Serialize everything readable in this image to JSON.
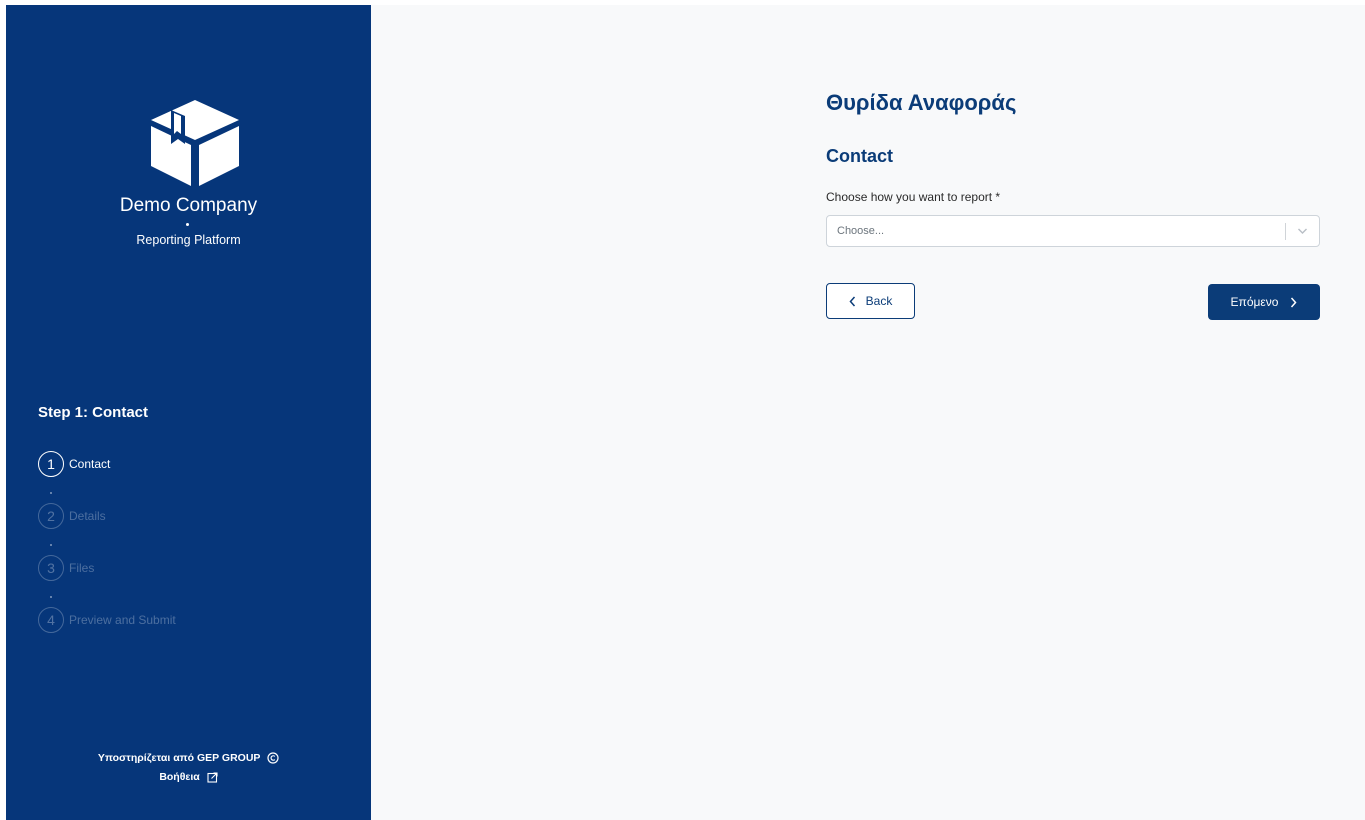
{
  "sidebar": {
    "company_name": "Demo Company",
    "platform_name": "Reporting Platform",
    "logo_icon": "box-icon",
    "step_title": "Step 1: Contact",
    "steps": [
      {
        "number": "1",
        "label": "Contact",
        "active": true
      },
      {
        "number": "2",
        "label": "Details",
        "active": false
      },
      {
        "number": "3",
        "label": "Files",
        "active": false
      },
      {
        "number": "4",
        "label": "Preview and Submit",
        "active": false
      }
    ],
    "footer": {
      "powered_by": "Υποστηρίζεται από GEP GROUP",
      "powered_icon": "copyright-icon",
      "help": "Βοήθεια",
      "help_icon": "external-link-icon"
    }
  },
  "main": {
    "page_title": "Θυρίδα Αναφοράς",
    "section_title": "Contact",
    "report_method": {
      "label": "Choose how you want to report *",
      "placeholder": "Choose..."
    },
    "back_button": "Back",
    "next_button": "Επόμενο"
  },
  "colors": {
    "sidebar_bg": "#06367a",
    "primary": "#0b3c78",
    "main_bg": "#f8f9fa"
  }
}
